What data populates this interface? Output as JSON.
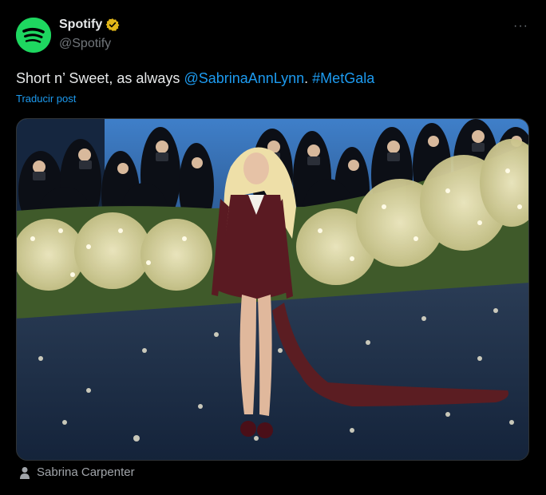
{
  "account": {
    "display_name": "Spotify",
    "handle": "@Spotify",
    "verified": true,
    "avatar_color": "#1ed760",
    "verified_badge_color": "#e2b719"
  },
  "menu": {
    "label": "···"
  },
  "tweet": {
    "text_prefix": "Short n’ Sweet, as always ",
    "mention": "@SabrinaAnnLynn",
    "text_mid": ". ",
    "hashtag": "#MetGala",
    "link_color": "#1d9bf0"
  },
  "translate": {
    "label": "Traducir post"
  },
  "media": {
    "icon": "photo",
    "tagged_user_icon": "user-icon",
    "tagged_user": "Sabrina Carpenter"
  }
}
